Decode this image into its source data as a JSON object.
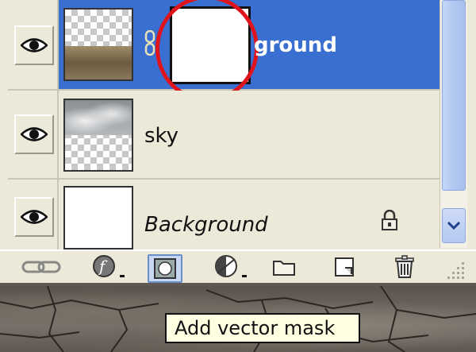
{
  "layers": [
    {
      "name": "ground",
      "selected": true
    },
    {
      "name": "sky",
      "selected": false
    },
    {
      "name": "Background",
      "selected": false
    }
  ],
  "toolbar": {
    "buttons": [
      {
        "icon": "link-layers-icon"
      },
      {
        "icon": "layer-style-icon"
      },
      {
        "icon": "add-vector-mask-icon"
      },
      {
        "icon": "adjustment-layer-icon"
      },
      {
        "icon": "new-group-icon"
      },
      {
        "icon": "new-layer-icon"
      },
      {
        "icon": "trash-icon"
      }
    ]
  },
  "tooltip": {
    "text": "Add vector mask"
  },
  "colors": {
    "selected_row": "#3a6fd2",
    "panel": "#ece9d8",
    "highlight_circle": "#e0141c",
    "tooltip_bg": "#ffffe1"
  }
}
